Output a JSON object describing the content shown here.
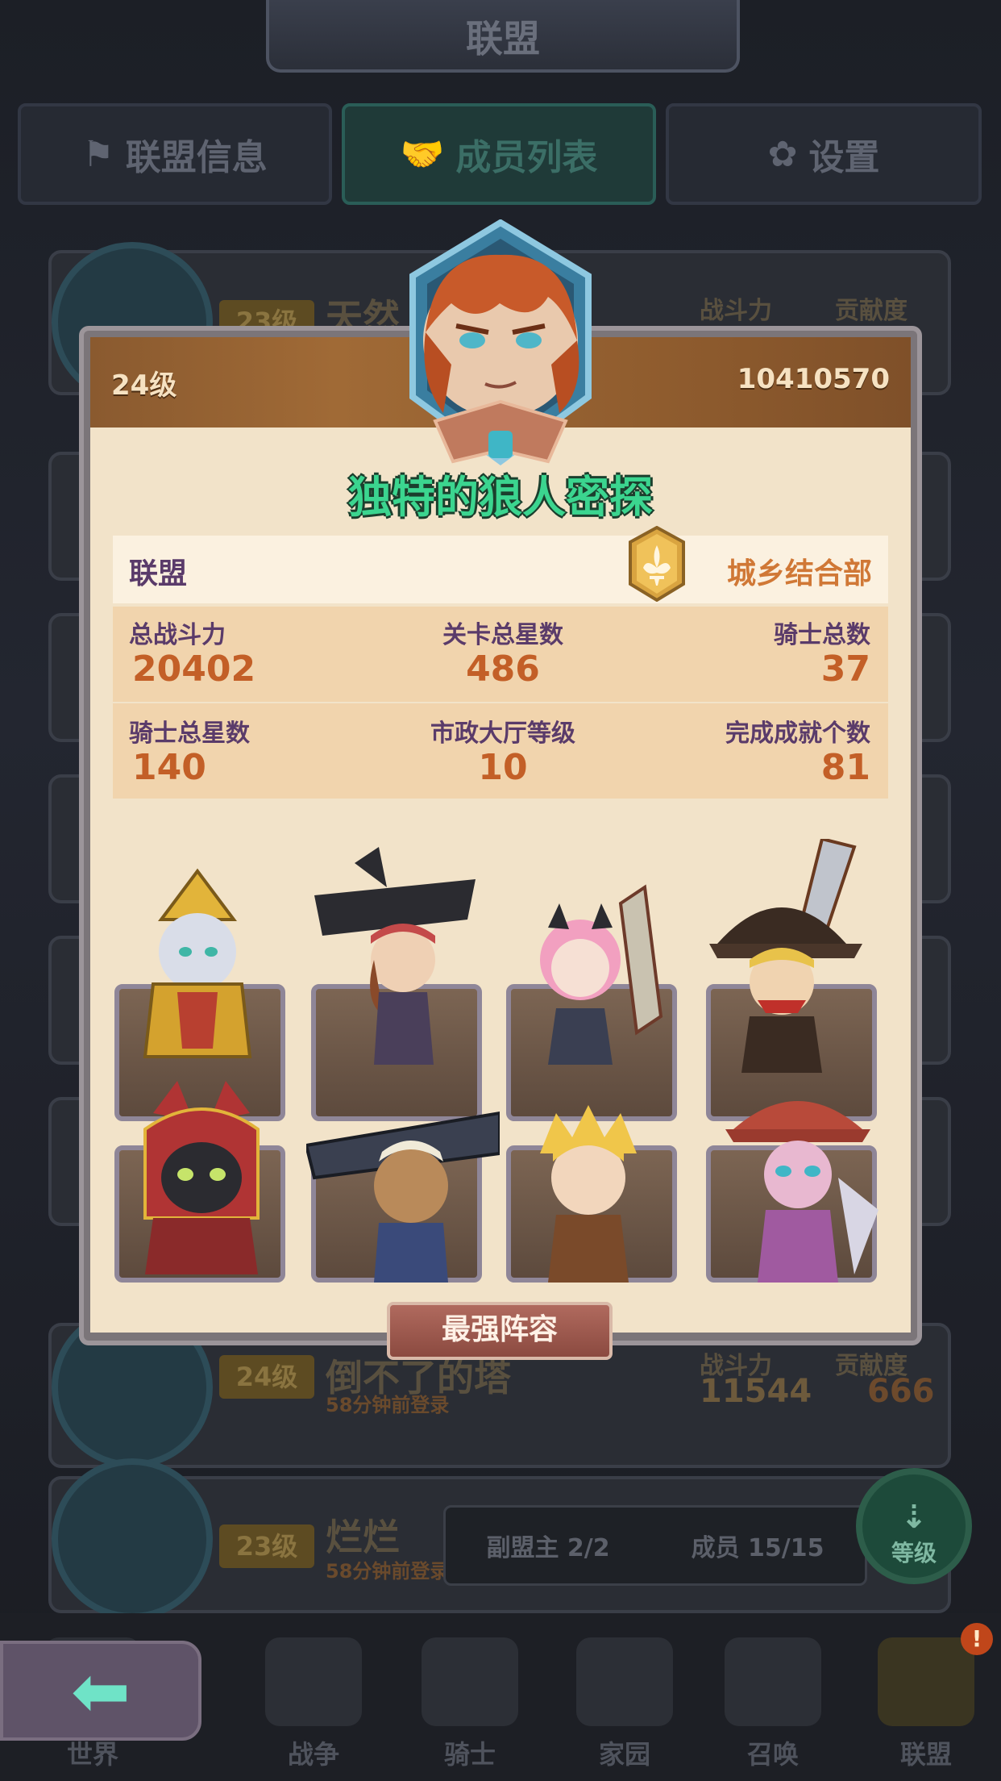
{
  "screen": {
    "title": "联盟",
    "tabs": [
      {
        "label": "联盟信息",
        "icon": "flag-icon",
        "active": false
      },
      {
        "label": "成员列表",
        "icon": "handshake-icon",
        "active": true
      },
      {
        "label": "设置",
        "icon": "gear-icon",
        "active": false
      }
    ]
  },
  "background_rows": [
    {
      "level": "23级",
      "name": "天然",
      "col1_header": "战斗力",
      "col2_header": "贡献度"
    },
    {
      "level": "24级",
      "name": "倒不了的塔",
      "status": "58分钟前登录",
      "col1_header": "战斗力",
      "col2_header": "贡献度",
      "power": "11544",
      "contribution": "666"
    },
    {
      "level": "23级",
      "name": "烂烂",
      "status": "58分钟前登录"
    }
  ],
  "role_bar": {
    "vice_leader_label": "副盟主 2/2",
    "member_label": "成员 15/15"
  },
  "sort_button": {
    "label": "等级"
  },
  "notice_badge": "!",
  "bottom_nav": [
    {
      "label": "世界"
    },
    {
      "label": "战争"
    },
    {
      "label": "骑士"
    },
    {
      "label": "家园"
    },
    {
      "label": "召唤"
    },
    {
      "label": "联盟"
    }
  ],
  "modal": {
    "level": "24级",
    "power": "10410570",
    "player_name": "独特的狼人密探",
    "alliance_label": "联盟",
    "alliance_name": "城乡结合部",
    "stats": [
      {
        "label": "总战斗力",
        "value": "20402"
      },
      {
        "label": "关卡总星数",
        "value": "486"
      },
      {
        "label": "骑士总数",
        "value": "37"
      },
      {
        "label": "骑士总星数",
        "value": "140"
      },
      {
        "label": "市政大厅等级",
        "value": "10"
      },
      {
        "label": "完成成就个数",
        "value": "81"
      }
    ],
    "lineup_button": "最强阵容"
  },
  "colors": {
    "name_green": "#3bd58f",
    "stat_value": "#c35f27",
    "stat_label": "#5a3b6a",
    "alliance_orange": "#d07836",
    "header_wood": "#a06a36"
  }
}
